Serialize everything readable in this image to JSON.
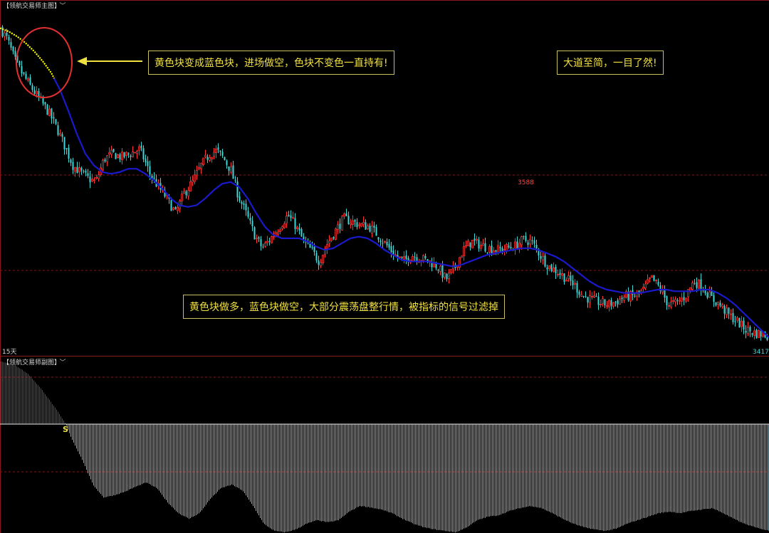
{
  "main_panel": {
    "title": "【领航交易师主图】",
    "period_label": "15天",
    "high_label": "3588",
    "low_label": "3417"
  },
  "sub_panel": {
    "title": "【领航交易师副图】",
    "signal_label": "S"
  },
  "annotations": {
    "entry_note": "黄色块变成蓝色块，进场做空，色块不变色一直持有!",
    "motto": "大道至简，一目了然!",
    "filter_note": "黄色块做多，蓝色块做空，大部分震荡盘整行情，被指标的信号过滤掉"
  },
  "colors": {
    "up_candle": "#ff3232",
    "down_candle": "#3fd6d6",
    "trend_bear": "#1a1acc",
    "trend_bull": "#ffff00",
    "osc_positive": "#d01818",
    "osc_negative": "#3ac8c8",
    "annotation_text": "#f0e040",
    "ellipse": "#e03030"
  },
  "chart_data": [
    {
      "type": "candlestick",
      "panel": "main",
      "period": "15天",
      "ylim": [
        3405,
        3620
      ],
      "max_marker": 3588,
      "min_marker": 3417,
      "close_path": [
        [
          0,
          3603
        ],
        [
          10,
          3596
        ],
        [
          20,
          3584
        ],
        [
          30,
          3576
        ],
        [
          42,
          3568
        ],
        [
          55,
          3560
        ],
        [
          68,
          3552
        ],
        [
          80,
          3542
        ],
        [
          92,
          3530
        ],
        [
          102,
          3520
        ],
        [
          112,
          3516
        ],
        [
          124,
          3512
        ],
        [
          134,
          3510
        ],
        [
          146,
          3524
        ],
        [
          158,
          3527
        ],
        [
          170,
          3525
        ],
        [
          182,
          3527
        ],
        [
          196,
          3530
        ],
        [
          210,
          3515
        ],
        [
          222,
          3507
        ],
        [
          234,
          3500
        ],
        [
          246,
          3491
        ],
        [
          258,
          3503
        ],
        [
          270,
          3510
        ],
        [
          282,
          3520
        ],
        [
          294,
          3527
        ],
        [
          304,
          3529
        ],
        [
          314,
          3524
        ],
        [
          324,
          3517
        ],
        [
          334,
          3502
        ],
        [
          346,
          3490
        ],
        [
          358,
          3477
        ],
        [
          368,
          3470
        ],
        [
          380,
          3476
        ],
        [
          392,
          3483
        ],
        [
          404,
          3490
        ],
        [
          414,
          3484
        ],
        [
          426,
          3474
        ],
        [
          438,
          3468
        ],
        [
          448,
          3462
        ],
        [
          458,
          3472
        ],
        [
          470,
          3480
        ],
        [
          482,
          3488
        ],
        [
          494,
          3486
        ],
        [
          506,
          3484
        ],
        [
          518,
          3483
        ],
        [
          530,
          3478
        ],
        [
          542,
          3472
        ],
        [
          554,
          3466
        ],
        [
          566,
          3462
        ],
        [
          578,
          3466
        ],
        [
          590,
          3464
        ],
        [
          602,
          3462
        ],
        [
          614,
          3459
        ],
        [
          626,
          3451
        ],
        [
          638,
          3458
        ],
        [
          650,
          3469
        ],
        [
          662,
          3474
        ],
        [
          674,
          3472
        ],
        [
          686,
          3470
        ],
        [
          698,
          3469
        ],
        [
          710,
          3470
        ],
        [
          722,
          3471
        ],
        [
          734,
          3475
        ],
        [
          746,
          3474
        ],
        [
          758,
          3466
        ],
        [
          770,
          3459
        ],
        [
          782,
          3456
        ],
        [
          794,
          3452
        ],
        [
          806,
          3448
        ],
        [
          818,
          3441
        ],
        [
          830,
          3439
        ],
        [
          842,
          3437
        ],
        [
          854,
          3436
        ],
        [
          866,
          3438
        ],
        [
          878,
          3441
        ],
        [
          890,
          3441
        ],
        [
          902,
          3444
        ],
        [
          914,
          3452
        ],
        [
          926,
          3446
        ],
        [
          938,
          3436
        ],
        [
          950,
          3437
        ],
        [
          962,
          3441
        ],
        [
          974,
          3450
        ],
        [
          986,
          3447
        ],
        [
          998,
          3440
        ],
        [
          1010,
          3436
        ],
        [
          1022,
          3430
        ],
        [
          1034,
          3426
        ],
        [
          1046,
          3421
        ],
        [
          1058,
          3419
        ],
        [
          1070,
          3418
        ],
        [
          1080,
          3417
        ]
      ],
      "trend_line": [
        [
          0,
          3603
        ],
        [
          12,
          3601
        ],
        [
          24,
          3598
        ],
        [
          36,
          3594
        ],
        [
          48,
          3589
        ],
        [
          60,
          3583
        ],
        [
          72,
          3576
        ],
        [
          84,
          3566
        ],
        [
          96,
          3553
        ],
        [
          108,
          3539
        ],
        [
          120,
          3527
        ],
        [
          132,
          3520
        ],
        [
          144,
          3516
        ],
        [
          156,
          3515
        ],
        [
          168,
          3516
        ],
        [
          180,
          3518
        ],
        [
          192,
          3518
        ],
        [
          204,
          3515
        ],
        [
          216,
          3511
        ],
        [
          228,
          3506
        ],
        [
          240,
          3500
        ],
        [
          252,
          3496
        ],
        [
          264,
          3495
        ],
        [
          276,
          3496
        ],
        [
          288,
          3500
        ],
        [
          300,
          3505
        ],
        [
          312,
          3509
        ],
        [
          324,
          3510
        ],
        [
          336,
          3507
        ],
        [
          348,
          3500
        ],
        [
          360,
          3491
        ],
        [
          372,
          3483
        ],
        [
          384,
          3478
        ],
        [
          396,
          3476
        ],
        [
          408,
          3476
        ],
        [
          420,
          3476
        ],
        [
          432,
          3474
        ],
        [
          444,
          3471
        ],
        [
          456,
          3469
        ],
        [
          468,
          3470
        ],
        [
          480,
          3473
        ],
        [
          492,
          3476
        ],
        [
          504,
          3477
        ],
        [
          516,
          3476
        ],
        [
          528,
          3473
        ],
        [
          540,
          3469
        ],
        [
          552,
          3466
        ],
        [
          564,
          3463
        ],
        [
          576,
          3462
        ],
        [
          588,
          3462
        ],
        [
          600,
          3462
        ],
        [
          612,
          3461
        ],
        [
          624,
          3460
        ],
        [
          636,
          3459
        ],
        [
          648,
          3460
        ],
        [
          660,
          3462
        ],
        [
          672,
          3464
        ],
        [
          684,
          3466
        ],
        [
          696,
          3467
        ],
        [
          708,
          3468
        ],
        [
          720,
          3469
        ],
        [
          732,
          3470
        ],
        [
          744,
          3470
        ],
        [
          756,
          3469
        ],
        [
          768,
          3467
        ],
        [
          780,
          3465
        ],
        [
          792,
          3462
        ],
        [
          804,
          3458
        ],
        [
          816,
          3454
        ],
        [
          828,
          3450
        ],
        [
          840,
          3447
        ],
        [
          852,
          3445
        ],
        [
          864,
          3444
        ],
        [
          876,
          3443
        ],
        [
          888,
          3443
        ],
        [
          900,
          3443
        ],
        [
          912,
          3444
        ],
        [
          924,
          3445
        ],
        [
          936,
          3445
        ],
        [
          948,
          3444
        ],
        [
          960,
          3444
        ],
        [
          972,
          3444
        ],
        [
          984,
          3445
        ],
        [
          996,
          3445
        ],
        [
          1008,
          3443
        ],
        [
          1020,
          3440
        ],
        [
          1032,
          3436
        ],
        [
          1044,
          3431
        ],
        [
          1056,
          3426
        ],
        [
          1068,
          3421
        ],
        [
          1080,
          3416
        ]
      ],
      "trend_color_switch_x": 76
    },
    {
      "type": "bar",
      "panel": "sub",
      "ylim": [
        -1.53,
        1.0
      ],
      "zero_line": 0,
      "sell_signal": {
        "label": "S",
        "x": 92
      },
      "values_path": [
        [
          0,
          0.95
        ],
        [
          20,
          0.9
        ],
        [
          40,
          0.75
        ],
        [
          60,
          0.5
        ],
        [
          80,
          0.2
        ],
        [
          92,
          0.0
        ],
        [
          100,
          -0.2
        ],
        [
          115,
          -0.5
        ],
        [
          130,
          -0.85
        ],
        [
          145,
          -1.03
        ],
        [
          160,
          -1.0
        ],
        [
          175,
          -0.95
        ],
        [
          190,
          -0.88
        ],
        [
          205,
          -0.82
        ],
        [
          220,
          -0.9
        ],
        [
          235,
          -1.1
        ],
        [
          250,
          -1.25
        ],
        [
          265,
          -1.33
        ],
        [
          280,
          -1.25
        ],
        [
          295,
          -1.05
        ],
        [
          310,
          -0.9
        ],
        [
          325,
          -0.85
        ],
        [
          340,
          -0.93
        ],
        [
          355,
          -1.15
        ],
        [
          370,
          -1.4
        ],
        [
          385,
          -1.5
        ],
        [
          400,
          -1.52
        ],
        [
          415,
          -1.48
        ],
        [
          430,
          -1.4
        ],
        [
          445,
          -1.35
        ],
        [
          460,
          -1.38
        ],
        [
          475,
          -1.35
        ],
        [
          490,
          -1.23
        ],
        [
          505,
          -1.15
        ],
        [
          520,
          -1.17
        ],
        [
          535,
          -1.2
        ],
        [
          550,
          -1.25
        ],
        [
          565,
          -1.33
        ],
        [
          580,
          -1.4
        ],
        [
          595,
          -1.45
        ],
        [
          610,
          -1.48
        ],
        [
          625,
          -1.5
        ],
        [
          640,
          -1.52
        ],
        [
          655,
          -1.45
        ],
        [
          670,
          -1.35
        ],
        [
          685,
          -1.3
        ],
        [
          700,
          -1.28
        ],
        [
          715,
          -1.22
        ],
        [
          730,
          -1.18
        ],
        [
          745,
          -1.15
        ],
        [
          760,
          -1.18
        ],
        [
          775,
          -1.25
        ],
        [
          790,
          -1.33
        ],
        [
          805,
          -1.4
        ],
        [
          820,
          -1.45
        ],
        [
          835,
          -1.48
        ],
        [
          850,
          -1.5
        ],
        [
          865,
          -1.47
        ],
        [
          880,
          -1.4
        ],
        [
          895,
          -1.35
        ],
        [
          910,
          -1.3
        ],
        [
          925,
          -1.25
        ],
        [
          940,
          -1.23
        ],
        [
          955,
          -1.25
        ],
        [
          970,
          -1.22
        ],
        [
          985,
          -1.2
        ],
        [
          1000,
          -1.18
        ],
        [
          1015,
          -1.25
        ],
        [
          1030,
          -1.33
        ],
        [
          1045,
          -1.4
        ],
        [
          1060,
          -1.45
        ],
        [
          1080,
          -1.5
        ]
      ]
    }
  ]
}
